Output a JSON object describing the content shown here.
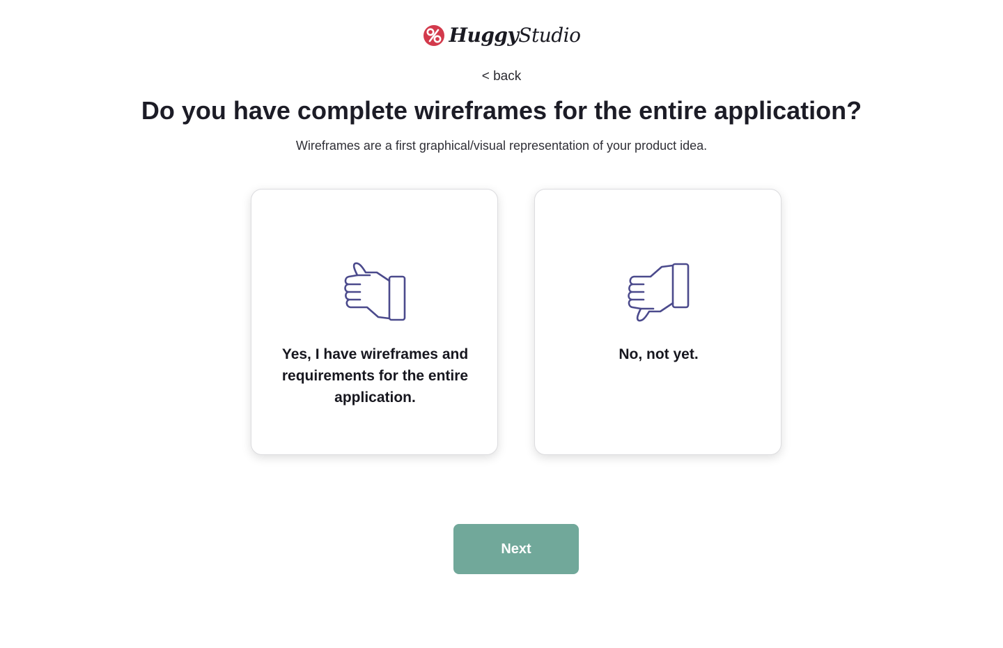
{
  "brand": {
    "name_bold": "Huggy",
    "name_regular": "Studio",
    "logo_icon": "percent-heart-icon",
    "accent_color": "#d33a4c"
  },
  "nav": {
    "back_label": "< back"
  },
  "question": {
    "title": "Do you have complete wireframes for the entire application?",
    "subtitle": "Wireframes are a first graphical/visual representation of your product idea."
  },
  "options": [
    {
      "icon": "thumbs-up-icon",
      "label": "Yes, I have wireframes and requirements for the entire application.",
      "selected": false
    },
    {
      "icon": "thumbs-down-icon",
      "label": "No, not yet.",
      "selected": false
    }
  ],
  "actions": {
    "next_label": "Next",
    "next_color": "#71a89a"
  },
  "colors": {
    "icon_stroke": "#4b4a8c",
    "text": "#1c1c26"
  }
}
